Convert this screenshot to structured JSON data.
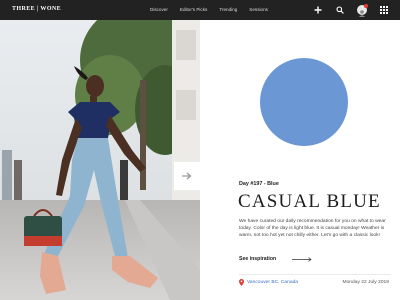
{
  "brand": {
    "logo_text": "THREE | WONE"
  },
  "nav": {
    "items": [
      "Discover",
      "Editor's Picks",
      "Trending",
      "Sessions"
    ]
  },
  "toolbar": {
    "icons": [
      "plus-icon",
      "search-icon",
      "avatar",
      "grid-icon"
    ],
    "notification_color": "#e53935"
  },
  "hero": {
    "next_icon": "arrow-right-icon"
  },
  "color_of_day": {
    "swatch_color": "#6b97d5",
    "day_label": "Day #197 - Blue",
    "title": "CASUAL BLUE",
    "description": "We have curated our daily recommendation for you on what to wear today. Color of the day is light blue. It is casual monday! Weather is warm, not too hot yet not chilly either. Let's go with a classic look!",
    "cta_label": "See inspiration"
  },
  "footer": {
    "location": "Vancouver BC, Canada",
    "date": "Monday 22 July 2019",
    "accent": "#3a6fc9"
  }
}
